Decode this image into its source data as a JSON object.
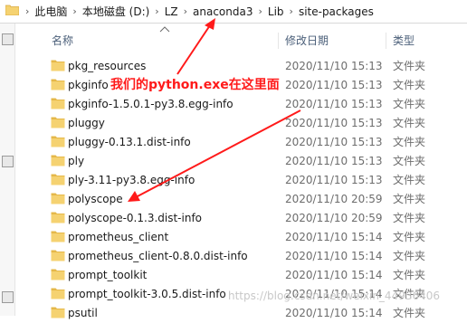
{
  "breadcrumb": [
    "此电脑",
    "本地磁盘 (D:)",
    "LZ",
    "anaconda3",
    "Lib",
    "site-packages"
  ],
  "header": {
    "name": "名称",
    "date": "修改日期",
    "type": "类型"
  },
  "rows": [
    {
      "name": "pkg_resources",
      "date": "2020/11/10 15:13",
      "type": "文件夹"
    },
    {
      "name": "pkginfo",
      "date": "2020/11/10 15:13",
      "type": "文件夹"
    },
    {
      "name": "pkginfo-1.5.0.1-py3.8.egg-info",
      "date": "2020/11/10 15:13",
      "type": "文件夹"
    },
    {
      "name": "pluggy",
      "date": "2020/11/10 15:13",
      "type": "文件夹"
    },
    {
      "name": "pluggy-0.13.1.dist-info",
      "date": "2020/11/10 15:13",
      "type": "文件夹"
    },
    {
      "name": "ply",
      "date": "2020/11/10 15:13",
      "type": "文件夹"
    },
    {
      "name": "ply-3.11-py3.8.egg-info",
      "date": "2020/11/10 15:13",
      "type": "文件夹"
    },
    {
      "name": "polyscope",
      "date": "2020/11/10 20:59",
      "type": "文件夹"
    },
    {
      "name": "polyscope-0.1.3.dist-info",
      "date": "2020/11/10 20:59",
      "type": "文件夹"
    },
    {
      "name": "prometheus_client",
      "date": "2020/11/10 15:14",
      "type": "文件夹"
    },
    {
      "name": "prometheus_client-0.8.0.dist-info",
      "date": "2020/11/10 15:14",
      "type": "文件夹"
    },
    {
      "name": "prompt_toolkit",
      "date": "2020/11/10 15:14",
      "type": "文件夹"
    },
    {
      "name": "prompt_toolkit-3.0.5.dist-info",
      "date": "2020/11/10 15:14",
      "type": "文件夹"
    },
    {
      "name": "psutil",
      "date": "2020/11/10 15:14",
      "type": "文件夹"
    }
  ],
  "annotation": "我们的python.exe在这里面",
  "annotation_color": "#ff1a1a",
  "watermark": "https://blog.csdn.net/weixin_44936406",
  "colors": {
    "folder": "#f5d271",
    "folder_dark": "#e5b84a",
    "header_text": "#4c607a"
  },
  "icons": {
    "folder": "folder-icon",
    "sort": "chevron-up-icon"
  }
}
